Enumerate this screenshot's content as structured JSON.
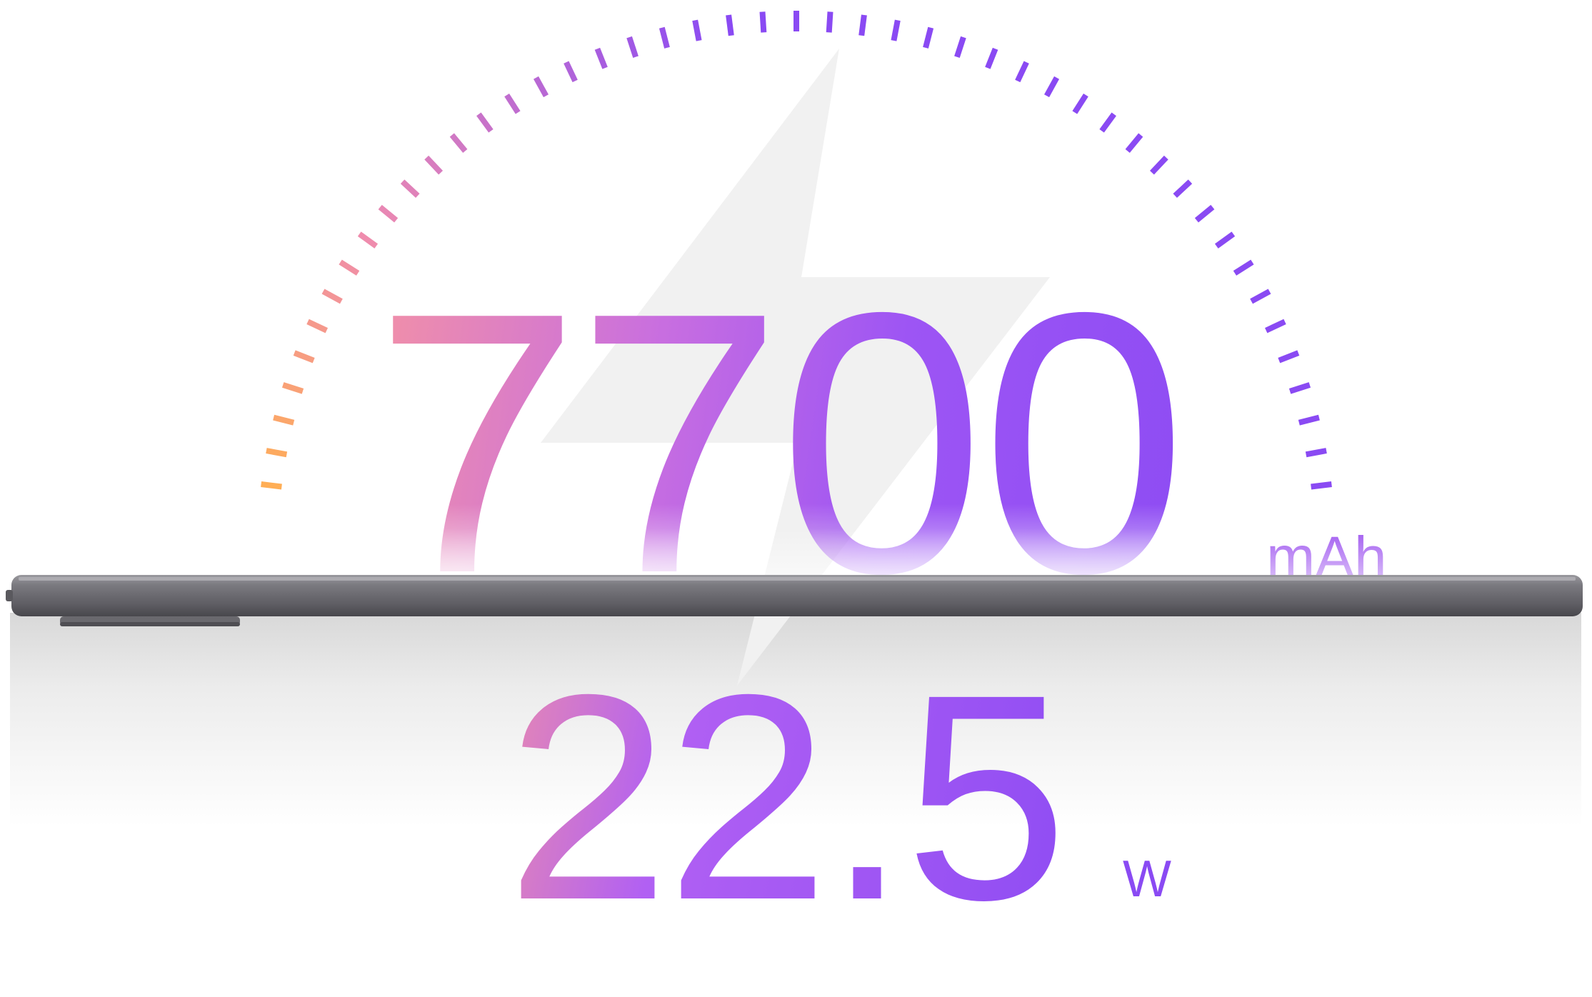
{
  "battery": {
    "value": "7700",
    "unit": "mAh"
  },
  "charging": {
    "value": "22.5",
    "unit": "W"
  },
  "colors": {
    "gradient_start": "#ff9b95",
    "gradient_mid": "#b160f3",
    "gradient_end": "#8a4af3",
    "dial_warm": "#ffae55",
    "dial_pink": "#ee8bb0",
    "dial_purple": "#8a4af3",
    "bolt": "#f2f2f2",
    "tablet_body": "#6f6e74"
  },
  "icons": {
    "dial": "gauge-dial-icon",
    "bolt": "lightning-bolt-icon",
    "device": "tablet-side-view"
  }
}
